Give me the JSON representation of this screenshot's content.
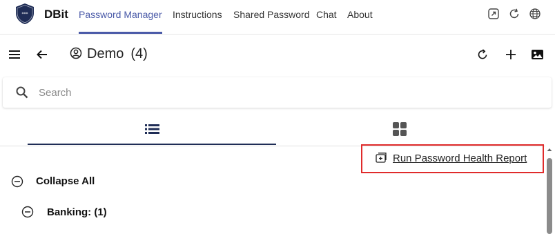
{
  "app": {
    "brand": "DBit"
  },
  "nav": {
    "items": [
      "Password Manager",
      "Instructions",
      "Shared Password",
      "Chat",
      "About"
    ],
    "active": "Password Manager"
  },
  "top_icons": [
    "open-external-icon",
    "refresh-icon",
    "globe-icon"
  ],
  "header": {
    "vault_name": "Demo",
    "vault_count": "(4)",
    "icons": [
      "menu-icon",
      "back-icon",
      "user-circle-icon",
      "reload-icon",
      "add-icon",
      "image-icon"
    ]
  },
  "search": {
    "placeholder": "Search",
    "value": ""
  },
  "view_tabs": {
    "icons": [
      "list-view-icon",
      "grid-view-icon"
    ],
    "active": "list"
  },
  "actions": {
    "health_report": "Run Password Health Report"
  },
  "tree": {
    "collapse_all": "Collapse All",
    "groups": [
      {
        "label": "Banking: (1)"
      }
    ]
  },
  "colors": {
    "accent": "#4a5aa8",
    "tab_indicator": "#1f2d56",
    "highlight_border": "#e02b2b",
    "logo": "#1f2d56"
  }
}
